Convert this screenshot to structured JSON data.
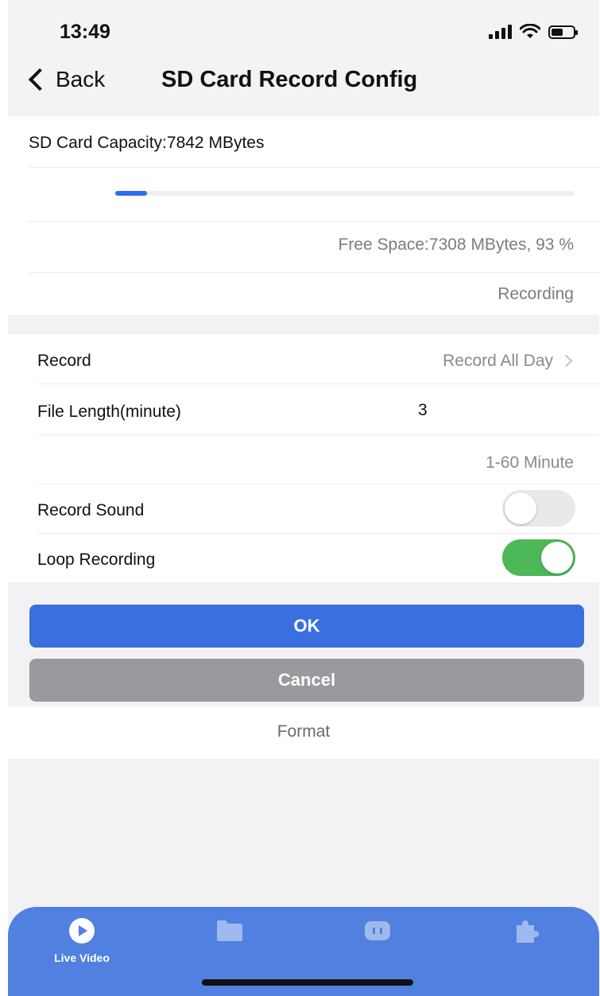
{
  "status_bar": {
    "time": "13:49",
    "icons": [
      "signal-icon",
      "wifi-icon",
      "battery-icon"
    ]
  },
  "nav": {
    "back_label": "Back",
    "title": "SD Card Record Config"
  },
  "capacity": {
    "label": "SD Card Capacity:7842 MBytes",
    "used_fraction": 0.07,
    "free_space_text": "Free Space:7308 MBytes, 93 %",
    "status_text": "Recording"
  },
  "settings": {
    "record": {
      "label": "Record",
      "value": "Record All Day"
    },
    "file_length": {
      "label": "File Length(minute)",
      "value": "3",
      "hint": "1-60 Minute"
    },
    "record_sound": {
      "label": "Record Sound",
      "enabled": false
    },
    "loop_recording": {
      "label": "Loop Recording",
      "enabled": true
    }
  },
  "buttons": {
    "ok_label": "OK",
    "cancel_label": "Cancel",
    "format_label": "Format"
  },
  "tab_bar": {
    "tabs": [
      {
        "label": "Live Video",
        "icon": "play-icon",
        "active": true
      },
      {
        "label": "",
        "icon": "folder-icon",
        "active": false
      },
      {
        "label": "",
        "icon": "message-icon",
        "active": false
      },
      {
        "label": "",
        "icon": "puzzle-icon",
        "active": false
      }
    ]
  },
  "colors": {
    "accent": "#3a6fe0",
    "tab_bar": "#5080e0",
    "toggle_on": "#4cb857",
    "cancel": "#9a9a9e"
  }
}
